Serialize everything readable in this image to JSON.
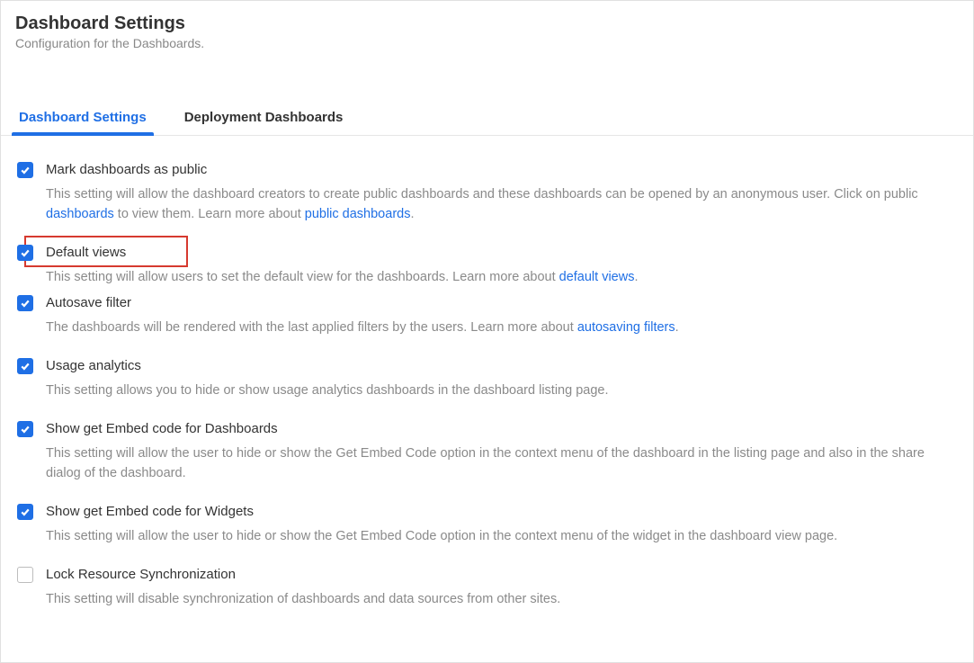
{
  "header": {
    "title": "Dashboard Settings",
    "subtitle": "Configuration for the Dashboards."
  },
  "tabs": {
    "dashboard_settings": "Dashboard Settings",
    "deployment_dashboards": "Deployment Dashboards"
  },
  "settings": {
    "mark_public": {
      "title": "Mark dashboards as public",
      "desc_a": "This setting will allow the dashboard creators to create public dashboards and these dashboards can be opened by an anonymous user. Click on public ",
      "link_a": "dashboards",
      "desc_b": " to view them. Learn more about ",
      "link_b": "public dashboards",
      "desc_c": ".",
      "checked": true
    },
    "default_views": {
      "title": "Default views",
      "desc_a": "This setting will allow users to set the default view for the dashboards. Learn more about ",
      "link_a": "default views",
      "desc_b": ".",
      "checked": true
    },
    "autosave_filter": {
      "title": "Autosave filter",
      "desc_a": "The dashboards will be rendered with the last applied filters by the users. Learn more about ",
      "link_a": "autosaving filters",
      "desc_b": ".",
      "checked": true
    },
    "usage_analytics": {
      "title": "Usage analytics",
      "desc_a": "This setting allows you to hide or show usage analytics dashboards in the dashboard listing page.",
      "checked": true
    },
    "embed_dashboards": {
      "title": "Show get Embed code for Dashboards",
      "desc_a": "This setting will allow the user to hide or show the Get Embed Code option in the context menu of the dashboard in the listing page and also in the share dialog of the dashboard.",
      "checked": true
    },
    "embed_widgets": {
      "title": "Show get Embed code for Widgets",
      "desc_a": "This setting will allow the user to hide or show the Get Embed Code option in the context menu of the widget in the dashboard view page.",
      "checked": true
    },
    "lock_sync": {
      "title": "Lock Resource Synchronization",
      "desc_a": "This setting will disable synchronization of dashboards and data sources from other sites.",
      "checked": false
    }
  }
}
